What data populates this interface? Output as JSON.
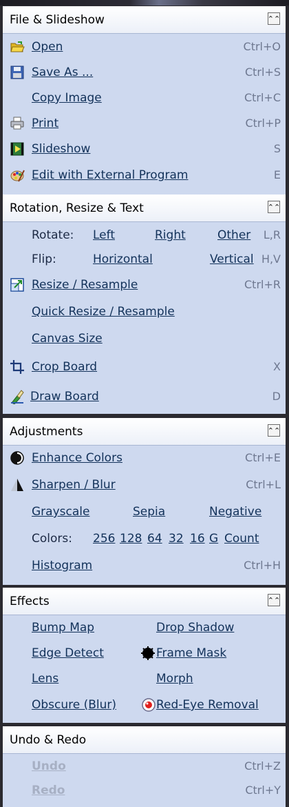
{
  "file": {
    "title": "File & Slideshow",
    "collapse_glyph": "⌃⌃",
    "open": {
      "label": "Open",
      "shortcut": "Ctrl+O"
    },
    "save_as": {
      "label": "Save As ...",
      "shortcut": "Ctrl+S"
    },
    "copy_image": {
      "label": "Copy Image",
      "shortcut": "Ctrl+C"
    },
    "print": {
      "label": "Print",
      "shortcut": "Ctrl+P"
    },
    "slideshow": {
      "label": "Slideshow",
      "shortcut": "S"
    },
    "edit_external": {
      "label": "Edit with External Program",
      "shortcut": "E"
    }
  },
  "rotation": {
    "title": "Rotation, Resize & Text",
    "rotate_label": "Rotate:",
    "rotate_left": "Left",
    "rotate_right": "Right",
    "rotate_other": "Other",
    "rotate_shortcut": "L,R",
    "flip_label": "Flip:",
    "flip_horizontal": "Horizontal",
    "flip_vertical": "Vertical",
    "flip_shortcut": "H,V",
    "resize": {
      "label": "Resize / Resample",
      "shortcut": "Ctrl+R"
    },
    "quick_resize": {
      "label": "Quick Resize / Resample"
    },
    "canvas_size": {
      "label": "Canvas Size"
    },
    "crop_board": {
      "label": "Crop Board",
      "shortcut": "X"
    },
    "draw_board": {
      "label": "Draw Board",
      "shortcut": "D"
    }
  },
  "adjustments": {
    "title": "Adjustments",
    "enhance_colors": {
      "label": "Enhance Colors",
      "shortcut": "Ctrl+E"
    },
    "sharpen_blur": {
      "label": "Sharpen / Blur",
      "shortcut": "Ctrl+L"
    },
    "grayscale": "Grayscale",
    "sepia": "Sepia",
    "negative": "Negative",
    "colors_label": "Colors:",
    "colors_options": [
      "256",
      "128",
      "64",
      "32",
      "16",
      "G",
      "Count"
    ],
    "histogram": {
      "label": "Histogram",
      "shortcut": "Ctrl+H"
    }
  },
  "effects": {
    "title": "Effects",
    "bump_map": "Bump Map",
    "drop_shadow": "Drop Shadow",
    "edge_detect": "Edge Detect",
    "frame_mask": "Frame Mask",
    "lens": "Lens",
    "morph": "Morph",
    "obscure": "Obscure (Blur)",
    "red_eye": "Red-Eye Removal"
  },
  "undo": {
    "title": "Undo & Redo",
    "undo": {
      "label": "Undo",
      "shortcut": "Ctrl+Z"
    },
    "redo": {
      "label": "Redo",
      "shortcut": "Ctrl+Y"
    }
  },
  "colors": {
    "panel_bg": "#ced9ef",
    "header_bg": "#ffffff",
    "link": "#13325a",
    "shortcut": "#6e7890",
    "disabled": "#a7b0c4"
  }
}
